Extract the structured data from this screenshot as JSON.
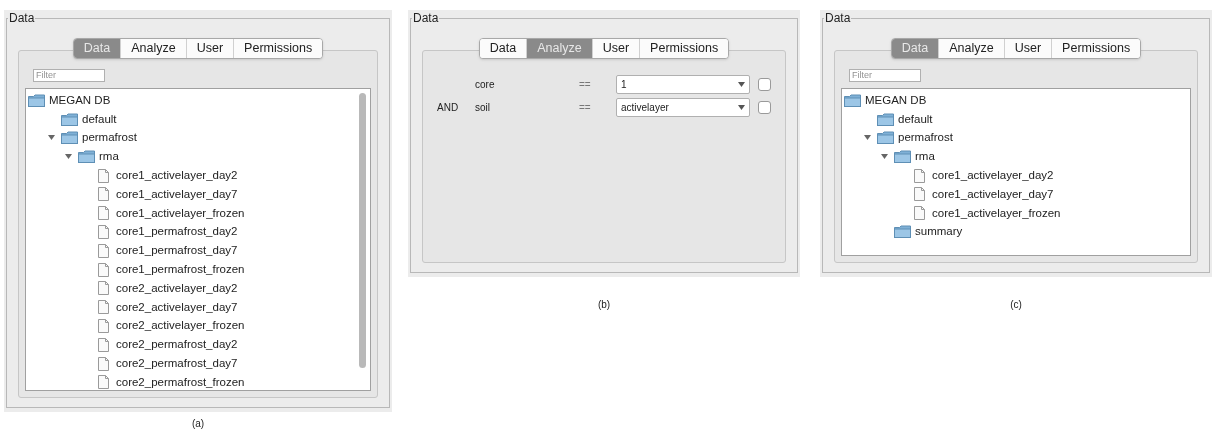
{
  "panels": [
    {
      "caption": "(a)",
      "group_title": "Data",
      "kind": "tree",
      "scrollbar": true,
      "tabs": [
        {
          "label": "Data",
          "selected": true
        },
        {
          "label": "Analyze",
          "selected": false
        },
        {
          "label": "User",
          "selected": false
        },
        {
          "label": "Permissions",
          "selected": false
        }
      ],
      "filter": {
        "placeholder": "Filter"
      },
      "tree": [
        {
          "label": "MEGAN DB",
          "kind": "folder",
          "children": [
            {
              "label": "default",
              "kind": "folder"
            },
            {
              "label": "permafrost",
              "kind": "folder",
              "expanded": true,
              "children": [
                {
                  "label": "rma",
                  "kind": "folder",
                  "expanded": true,
                  "children": [
                    {
                      "label": "core1_activelayer_day2",
                      "kind": "file"
                    },
                    {
                      "label": "core1_activelayer_day7",
                      "kind": "file"
                    },
                    {
                      "label": "core1_activelayer_frozen",
                      "kind": "file"
                    },
                    {
                      "label": "core1_permafrost_day2",
                      "kind": "file"
                    },
                    {
                      "label": "core1_permafrost_day7",
                      "kind": "file"
                    },
                    {
                      "label": "core1_permafrost_frozen",
                      "kind": "file"
                    },
                    {
                      "label": "core2_activelayer_day2",
                      "kind": "file"
                    },
                    {
                      "label": "core2_activelayer_day7",
                      "kind": "file"
                    },
                    {
                      "label": "core2_activelayer_frozen",
                      "kind": "file"
                    },
                    {
                      "label": "core2_permafrost_day2",
                      "kind": "file"
                    },
                    {
                      "label": "core2_permafrost_day7",
                      "kind": "file"
                    },
                    {
                      "label": "core2_permafrost_frozen",
                      "kind": "file"
                    }
                  ]
                }
              ]
            }
          ]
        }
      ]
    },
    {
      "caption": "(b)",
      "group_title": "Data",
      "kind": "query",
      "tabs": [
        {
          "label": "Data",
          "selected": false
        },
        {
          "label": "Analyze",
          "selected": true
        },
        {
          "label": "User",
          "selected": false
        },
        {
          "label": "Permissions",
          "selected": false
        }
      ],
      "conditions": [
        {
          "field": "core",
          "operator": "==",
          "value": "1",
          "checked": false
        },
        {
          "conjunction": "AND",
          "field": "soil",
          "operator": "==",
          "value": "activelayer",
          "checked": false
        }
      ]
    },
    {
      "caption": "(c)",
      "group_title": "Data",
      "kind": "tree",
      "tabs": [
        {
          "label": "Data",
          "selected": true
        },
        {
          "label": "Analyze",
          "selected": false
        },
        {
          "label": "User",
          "selected": false
        },
        {
          "label": "Permissions",
          "selected": false
        }
      ],
      "filter": {
        "placeholder": "Filter"
      },
      "tree": [
        {
          "label": "MEGAN DB",
          "kind": "folder",
          "children": [
            {
              "label": "default",
              "kind": "folder"
            },
            {
              "label": "permafrost",
              "kind": "folder",
              "expanded": true,
              "children": [
                {
                  "label": "rma",
                  "kind": "folder",
                  "expanded": true,
                  "children": [
                    {
                      "label": "core1_activelayer_day2",
                      "kind": "file"
                    },
                    {
                      "label": "core1_activelayer_day7",
                      "kind": "file"
                    },
                    {
                      "label": "core1_activelayer_frozen",
                      "kind": "file"
                    }
                  ]
                },
                {
                  "label": "summary",
                  "kind": "folder"
                }
              ]
            }
          ]
        }
      ]
    }
  ]
}
